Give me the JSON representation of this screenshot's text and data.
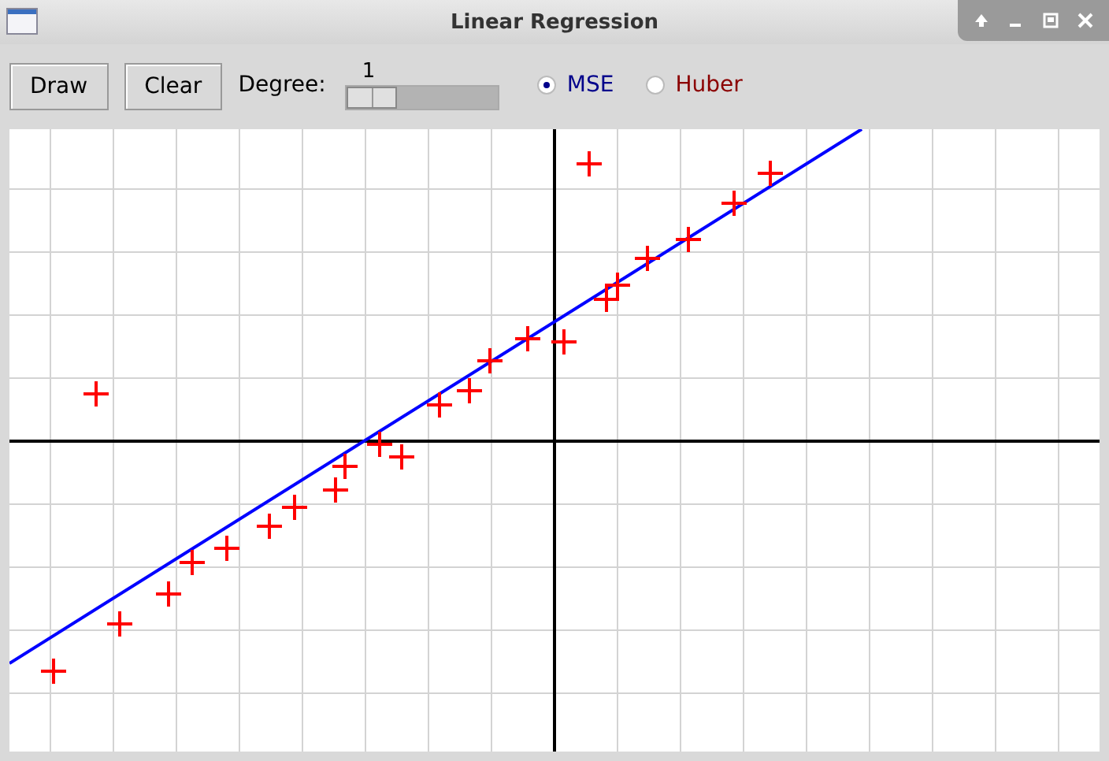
{
  "window": {
    "title": "Linear Regression"
  },
  "toolbar": {
    "buttons": [
      "Draw",
      "Clear"
    ],
    "degree": {
      "label": "Degree:",
      "value": "1",
      "level": 0
    },
    "loss_options": [
      {
        "label": "MSE",
        "selected": true,
        "color": "#00008b"
      },
      {
        "label": "Huber",
        "selected": false,
        "color": "#8b0000"
      }
    ]
  }
}
